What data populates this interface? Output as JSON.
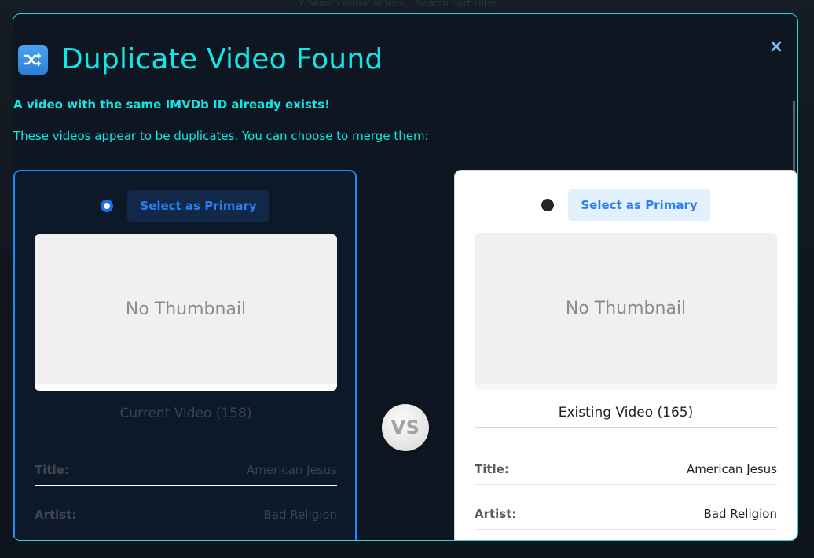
{
  "background": {
    "top_text": "Y   Search music videos...   Search  Sort  Filter"
  },
  "modal": {
    "title": "Duplicate Video Found",
    "header_icon": "shuffle-icon",
    "close_icon": "close-icon",
    "warning": "A video with the same IMVDb ID already exists!",
    "intro": "These videos appear to be duplicates. You can choose to merge them:",
    "vs_label": "VS",
    "colors": {
      "accent_cyan": "#14e6e6",
      "primary_blue": "#1e88ff",
      "modal_bg": "#0e1621"
    }
  },
  "cards": {
    "current": {
      "select_label": "Select as Primary",
      "selected": true,
      "thumbnail_text": "No Thumbnail",
      "video_label": "Current Video (158)",
      "fields": [
        {
          "label": "Title:",
          "value": "American Jesus"
        },
        {
          "label": "Artist:",
          "value": "Bad Religion"
        }
      ]
    },
    "existing": {
      "select_label": "Select as Primary",
      "selected": false,
      "thumbnail_text": "No Thumbnail",
      "video_label": "Existing Video (165)",
      "fields": [
        {
          "label": "Title:",
          "value": "American Jesus"
        },
        {
          "label": "Artist:",
          "value": "Bad Religion"
        }
      ]
    }
  }
}
